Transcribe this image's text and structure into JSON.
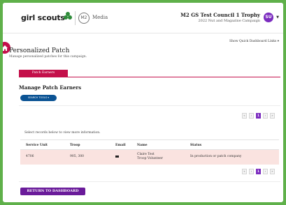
{
  "header": {
    "logo_text": "girl scouts",
    "media_logo_text": "M2",
    "media_text": "Media",
    "council_name": "M2 GS Test Council 1 Trophy",
    "council_sub": "2022 Nut and Magazine Campaign",
    "avatar_initials": "SU"
  },
  "quick_links": "Show Quick Dashboard Links",
  "page": {
    "title": "Personalized Patch",
    "description": "Manage personalized patches for this campaign."
  },
  "tabs": [
    {
      "label": "Patch Earners"
    }
  ],
  "section": {
    "title": "Manage Patch Earners",
    "search_button": "SEARCH TOOLS"
  },
  "pager": {
    "first": "«",
    "prev": "‹",
    "current": "1",
    "next": "›",
    "last": "»"
  },
  "select_hint": "Select records below to view more information.",
  "table": {
    "headers": [
      "Service Unit",
      "Troop",
      "Email",
      "Name",
      "Status"
    ],
    "rows": [
      {
        "service_unit": "4706",
        "troop": "905, 300",
        "name_line1": "Claire Test",
        "name_line2": "Troop Volunteer",
        "status": "In production or patch company"
      }
    ]
  },
  "return_button": "RETURN TO DASHBOARD",
  "colors": {
    "brand_green": "#5fb04a",
    "accent_magenta": "#c40f4a",
    "accent_purple": "#6a1b9a",
    "button_blue": "#0b5394",
    "row_highlight": "#fae3e0"
  }
}
